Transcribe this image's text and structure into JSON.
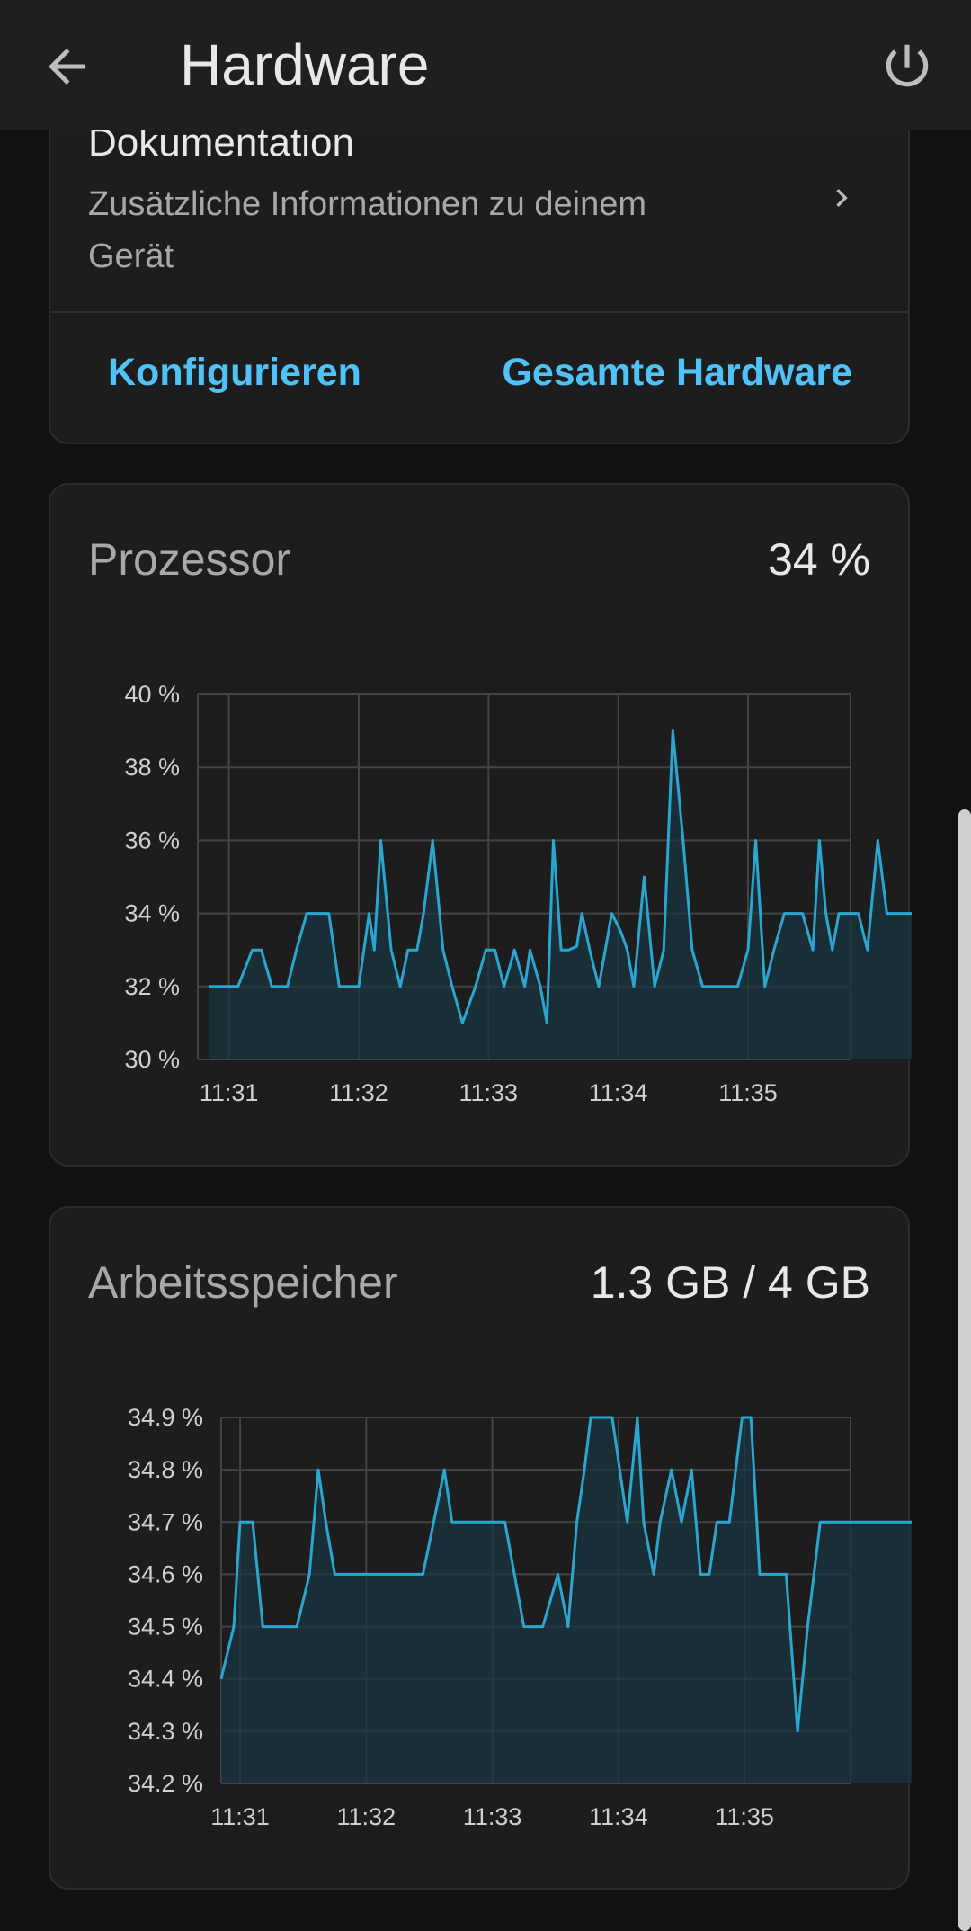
{
  "app_bar": {
    "title": "Hardware",
    "back_icon": "arrow-left-icon",
    "power_icon": "power-icon"
  },
  "documentation_card": {
    "title": "Dokumentation",
    "subtitle": "Zusätzliche Informationen zu deinem Gerät",
    "configure_label": "Konfigurieren",
    "all_hardware_label": "Gesamte Hardware"
  },
  "processor": {
    "title": "Prozessor",
    "value": "34 %"
  },
  "memory": {
    "title": "Arbeitsspeicher",
    "value": "1.3 GB / 4 GB"
  },
  "colors": {
    "accent": "#4fc3f7",
    "line": "#2aa6d1",
    "fill": "#1a3440",
    "grid": "#444444"
  },
  "chart_data": [
    {
      "type": "area",
      "title": "",
      "y_unit": "%",
      "ylim": [
        30,
        40
      ],
      "y_ticks": [
        "30 %",
        "32 %",
        "34 %",
        "36 %",
        "38 %",
        "40 %"
      ],
      "x_ticks": [
        "11:31",
        "11:32",
        "11:33",
        "11:34",
        "11:35"
      ],
      "grid": true,
      "x_minutes": [
        -0.15,
        0.0,
        0.07,
        0.18,
        0.25,
        0.33,
        0.45,
        0.52,
        0.6,
        0.7,
        0.77,
        0.85,
        0.92,
        1.0,
        1.08,
        1.12,
        1.17,
        1.25,
        1.32,
        1.38,
        1.45,
        1.5,
        1.57,
        1.65,
        1.72,
        1.8,
        1.9,
        1.98,
        2.05,
        2.12,
        2.2,
        2.28,
        2.32,
        2.4,
        2.45,
        2.5,
        2.56,
        2.62,
        2.68,
        2.72,
        2.78,
        2.85,
        2.95,
        3.02,
        3.07,
        3.12,
        3.2,
        3.28,
        3.35,
        3.42,
        3.5,
        3.57,
        3.65,
        3.72,
        3.78,
        3.85,
        3.92,
        4.0,
        4.06,
        4.13,
        4.2,
        4.28,
        4.35,
        4.42,
        4.5,
        4.55,
        4.6,
        4.65,
        4.7,
        4.77,
        4.85,
        4.92,
        5.0,
        5.07,
        5.15,
        5.21,
        5.25,
        5.28,
        5.33,
        5.45,
        5.52,
        5.59,
        5.63,
        5.69,
        5.73
      ],
      "series": [
        {
          "values": [
            32,
            32,
            32,
            33,
            33,
            32,
            32,
            33,
            34,
            34,
            34,
            32,
            32,
            32,
            34,
            33,
            36,
            33,
            32,
            33,
            33,
            34,
            36,
            33,
            32,
            31,
            32,
            33,
            33,
            32,
            33,
            32,
            33,
            32,
            31,
            36,
            33,
            33,
            33.1,
            34,
            33,
            32,
            34,
            33.5,
            33,
            32,
            35,
            32,
            33,
            39,
            36,
            33,
            32,
            32,
            32,
            32,
            32,
            33,
            36,
            32,
            33,
            34,
            34,
            34,
            33,
            36,
            34,
            33,
            34,
            34,
            34,
            33,
            36,
            34,
            34,
            34,
            34,
            34,
            34,
            34,
            34,
            34,
            34,
            34,
            34
          ]
        }
      ]
    },
    {
      "type": "area",
      "title": "",
      "y_unit": "%",
      "ylim": [
        34.2,
        34.9
      ],
      "y_ticks": [
        "34.2 %",
        "34.3 %",
        "34.4 %",
        "34.5 %",
        "34.6 %",
        "34.7 %",
        "34.8 %",
        "34.9 %"
      ],
      "x_ticks": [
        "11:31",
        "11:32",
        "11:33",
        "11:34",
        "11:35"
      ],
      "grid": true,
      "x_minutes": [
        -0.15,
        -0.05,
        0.0,
        0.1,
        0.18,
        0.3,
        0.45,
        0.55,
        0.62,
        0.68,
        0.75,
        1.0,
        1.2,
        1.45,
        1.62,
        1.68,
        1.75,
        1.95,
        2.1,
        2.25,
        2.4,
        2.52,
        2.6,
        2.67,
        2.73,
        2.78,
        2.95,
        3.07,
        3.15,
        3.2,
        3.28,
        3.33,
        3.42,
        3.5,
        3.58,
        3.65,
        3.72,
        3.78,
        3.88,
        3.98,
        4.05,
        4.12,
        4.2,
        4.27,
        4.33,
        4.42,
        4.5,
        4.6,
        4.68,
        4.75,
        4.85,
        4.98,
        5.05,
        5.12,
        5.2,
        5.4,
        5.53,
        5.63,
        5.73
      ],
      "series": [
        {
          "values": [
            34.4,
            34.5,
            34.7,
            34.7,
            34.5,
            34.5,
            34.5,
            34.6,
            34.8,
            34.7,
            34.6,
            34.6,
            34.6,
            34.6,
            34.8,
            34.7,
            34.7,
            34.7,
            34.7,
            34.5,
            34.5,
            34.6,
            34.5,
            34.7,
            34.8,
            34.9,
            34.9,
            34.7,
            34.9,
            34.7,
            34.6,
            34.7,
            34.8,
            34.7,
            34.8,
            34.6,
            34.6,
            34.7,
            34.7,
            34.9,
            34.9,
            34.6,
            34.6,
            34.6,
            34.6,
            34.3,
            34.5,
            34.7,
            34.7,
            34.7,
            34.7,
            34.7,
            34.7,
            34.7,
            34.7,
            34.7,
            34.7,
            34.7,
            34.7
          ]
        }
      ]
    }
  ]
}
